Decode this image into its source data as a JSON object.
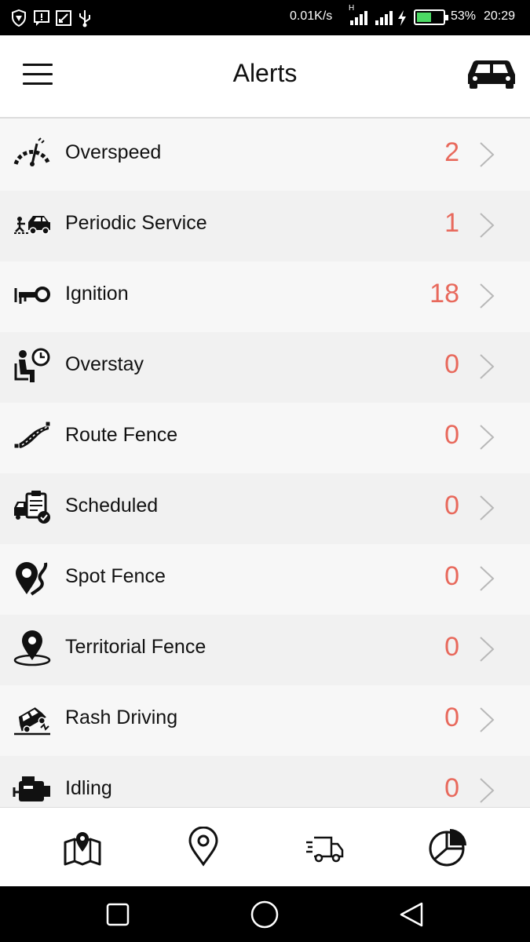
{
  "status_bar": {
    "net_speed": "0.01K/s",
    "network_type": "H",
    "battery_percent": "53%",
    "battery_level": 0.53,
    "time": "20:29",
    "icons": [
      "shield-icon",
      "message-icon",
      "screenshot-icon",
      "usb-icon",
      "signal-icon",
      "signal-icon",
      "charging-icon",
      "battery-icon"
    ]
  },
  "header": {
    "title": "Alerts",
    "menu_icon": "hamburger-menu-icon",
    "vehicle_icon": "car-icon"
  },
  "alerts": [
    {
      "label": "Overspeed",
      "count": "2",
      "icon": "speedometer-icon"
    },
    {
      "label": "Periodic Service",
      "count": "1",
      "icon": "tow-truck-icon"
    },
    {
      "label": "Ignition",
      "count": "18",
      "icon": "key-icon"
    },
    {
      "label": "Overstay",
      "count": "0",
      "icon": "waiting-person-clock-icon"
    },
    {
      "label": "Route Fence",
      "count": "0",
      "icon": "route-icon"
    },
    {
      "label": "Scheduled",
      "count": "0",
      "icon": "schedule-clipboard-icon"
    },
    {
      "label": "Spot Fence",
      "count": "0",
      "icon": "spot-pin-icon"
    },
    {
      "label": "Territorial Fence",
      "count": "0",
      "icon": "territory-pin-icon"
    },
    {
      "label": "Rash Driving",
      "count": "0",
      "icon": "crash-car-icon"
    },
    {
      "label": "Idling",
      "count": "0",
      "icon": "engine-icon"
    }
  ],
  "bottom_nav": [
    "map-icon",
    "location-pin-icon",
    "delivery-truck-icon",
    "pie-chart-icon"
  ],
  "colors": {
    "count": "#e8695c",
    "status_bar": "#000000",
    "header_bg": "#ffffff",
    "battery_fill": "#4cd964"
  }
}
